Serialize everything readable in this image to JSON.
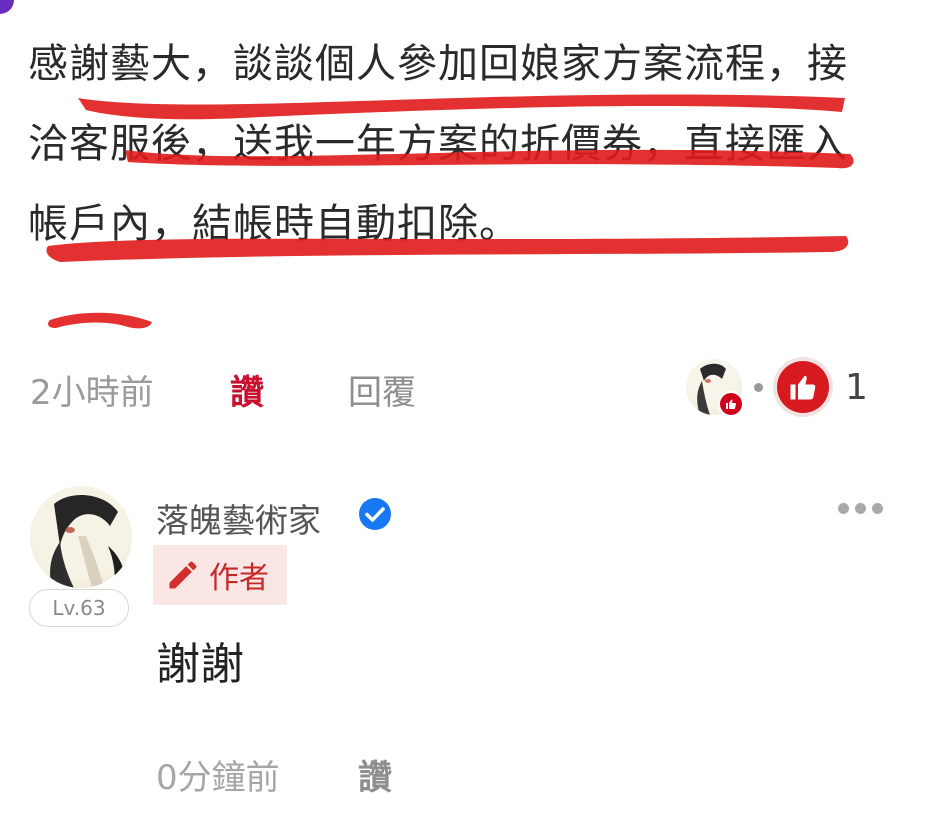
{
  "comment": {
    "text": "感謝藝大，談談個人參加回娘家方案流程，接洽客服後，送我一年方案的折價券，直接匯入帳戶內，結帳時自動扣除。",
    "time": "2小時前",
    "like_label": "讚",
    "reply_label": "回覆",
    "reaction_count": "1"
  },
  "reply": {
    "author_name": "落魄藝術家",
    "author_tag": "作者",
    "level": "Lv.63",
    "text": "謝謝",
    "time": "0分鐘前",
    "like_label": "讚"
  },
  "colors": {
    "like_active": "#c8102e",
    "author_tag_bg": "#fbe6e6",
    "verified": "#1877f2",
    "reaction_red": "#d71920",
    "corner_badge": "#6a2bbf"
  },
  "icons": [
    "verified-check-icon",
    "pencil-icon",
    "thumbs-up-icon",
    "more-options-icon"
  ]
}
